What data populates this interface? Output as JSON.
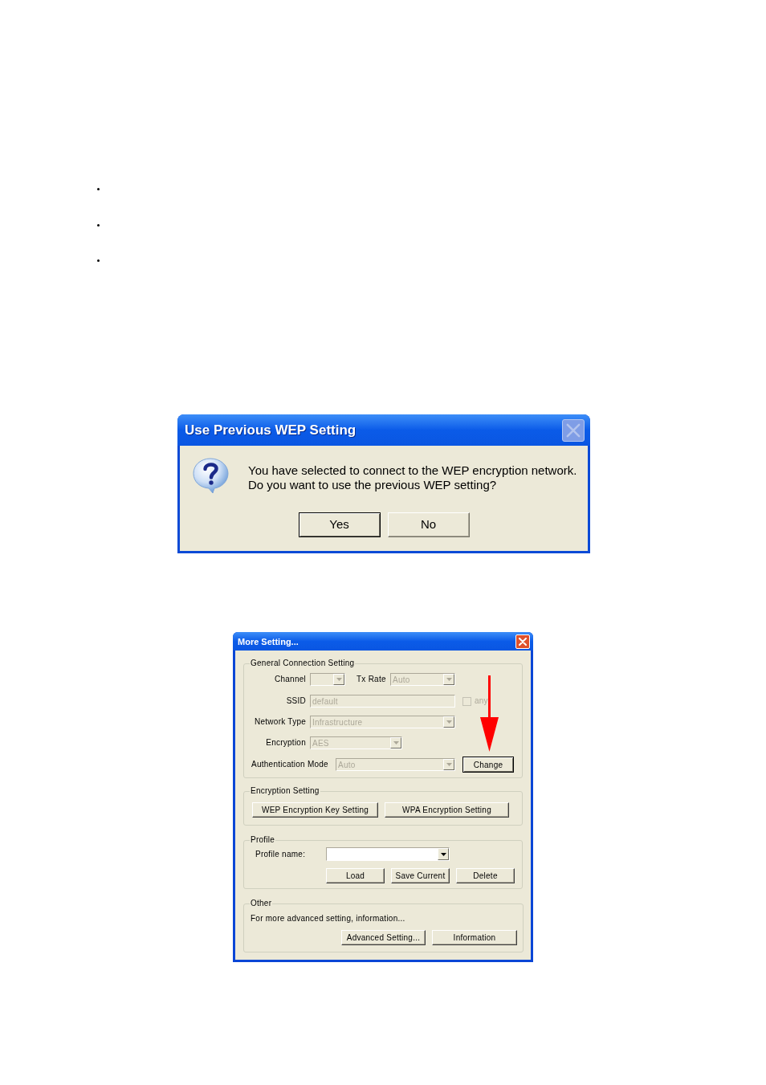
{
  "bullets": [
    {
      "kind": "dot"
    },
    {
      "kind": "dot"
    },
    {
      "kind": "dot"
    }
  ],
  "confirm_dialog": {
    "title": "Use Previous WEP Setting",
    "close_button": {
      "disabled": true
    },
    "message_lines": [
      "You have selected to connect to the WEP encryption network.",
      "Do you want to use the previous WEP setting?"
    ],
    "buttons": [
      {
        "label": "Yes",
        "default": true
      },
      {
        "label": "No",
        "default": false
      }
    ]
  },
  "settings_dialog": {
    "title": "More Setting...",
    "close_button": {
      "disabled": false
    },
    "general": {
      "legend": "General Connection Setting",
      "channel": {
        "label": "Channel",
        "disabled": true
      },
      "tx_rate": {
        "label": "Tx Rate",
        "value": "Auto",
        "disabled": true
      },
      "ssid": {
        "label": "SSID",
        "value": "default",
        "disabled": true
      },
      "any_checkbox": {
        "label": "any",
        "checked": false,
        "disabled": true
      },
      "network_type": {
        "label": "Network Type",
        "value": "Infrastructure",
        "disabled": true
      },
      "encryption": {
        "label": "Encryption",
        "value": "AES",
        "disabled": true
      },
      "authentication_mode": {
        "label": "Authentication Mode",
        "value": "Auto",
        "disabled": true
      },
      "change_button": {
        "label": "Change",
        "default": true
      }
    },
    "encryption_setting": {
      "legend": "Encryption Setting",
      "buttons": [
        {
          "label": "WEP Encryption Key Setting"
        },
        {
          "label": "WPA Encryption Setting"
        }
      ]
    },
    "profile": {
      "legend": "Profile",
      "profile_name": {
        "label": "Profile name:",
        "disabled": false
      },
      "buttons": [
        {
          "label": "Load"
        },
        {
          "label": "Save Current"
        },
        {
          "label": "Delete"
        }
      ]
    },
    "other": {
      "legend": "Other",
      "text": "For more advanced setting, information...",
      "buttons": [
        {
          "label": "Advanced Setting..."
        },
        {
          "label": "Information"
        }
      ]
    }
  }
}
